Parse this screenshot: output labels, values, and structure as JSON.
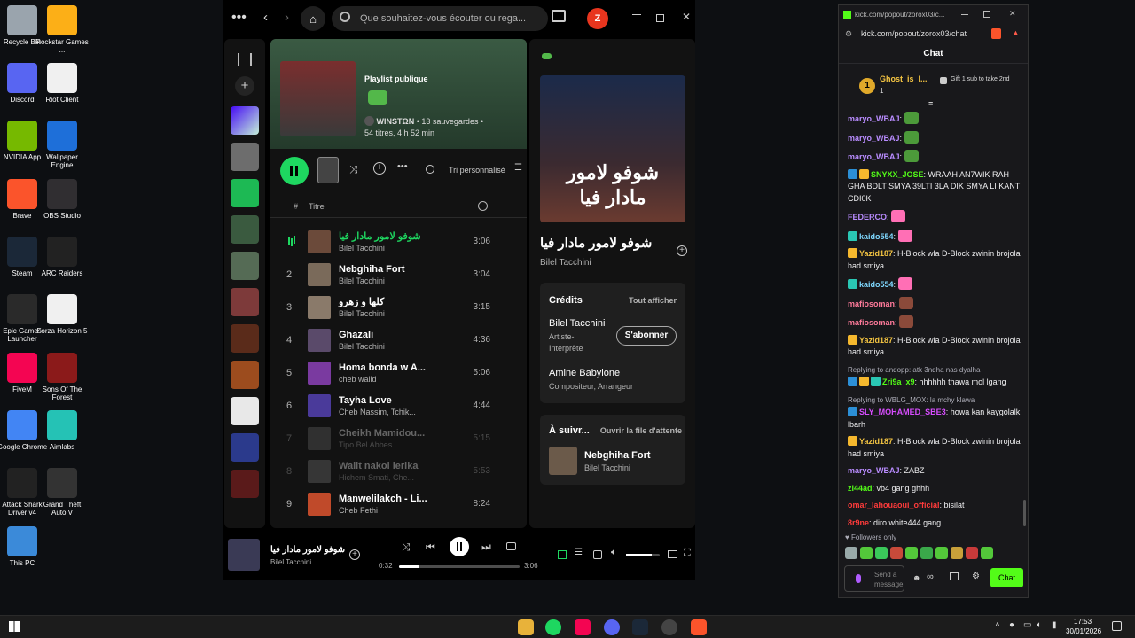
{
  "desktop": {
    "icons": [
      {
        "label": "Recycle Bin",
        "icon": "recycle-bin-icon",
        "color": "#9aa4ad"
      },
      {
        "label": "Rockstar Games ...",
        "icon": "rockstar-icon",
        "color": "#fcaf17"
      },
      {
        "label": "Discord",
        "icon": "discord-icon",
        "color": "#5865f2"
      },
      {
        "label": "Riot Client",
        "icon": "file-icon",
        "color": "#f0f0f0"
      },
      {
        "label": "NVIDIA App",
        "icon": "nvidia-icon",
        "color": "#76b900"
      },
      {
        "label": "Wallpaper Engine",
        "icon": "wallpaper-engine-icon",
        "color": "#1e6fd9"
      },
      {
        "label": "Brave",
        "icon": "brave-icon",
        "color": "#fb542b"
      },
      {
        "label": "OBS Studio",
        "icon": "obs-icon",
        "color": "#302e31"
      },
      {
        "label": "Steam",
        "icon": "steam-icon",
        "color": "#1b2838"
      },
      {
        "label": "ARC Raiders",
        "icon": "arc-raiders-icon",
        "color": "#222"
      },
      {
        "label": "Epic Games Launcher",
        "icon": "epic-icon",
        "color": "#2a2a2a"
      },
      {
        "label": "Forza Horizon 5",
        "icon": "file-icon",
        "color": "#f0f0f0"
      },
      {
        "label": "FiveM",
        "icon": "fivem-icon",
        "color": "#f40552"
      },
      {
        "label": "Sons Of The Forest",
        "icon": "sotf-icon",
        "color": "#8b1a1a"
      },
      {
        "label": "Google Chrome",
        "icon": "chrome-icon",
        "color": "#4285f4"
      },
      {
        "label": "Aimlabs",
        "icon": "aimlabs-icon",
        "color": "#25c2b5"
      },
      {
        "label": "Attack Shark Driver v4",
        "icon": "attack-shark-icon",
        "color": "#222"
      },
      {
        "label": "Grand Theft Auto V",
        "icon": "gta-icon",
        "color": "#333"
      },
      {
        "label": "This PC",
        "icon": "this-pc-icon",
        "color": "#3b8ad9"
      }
    ]
  },
  "spotify": {
    "search_placeholder": "Que souhaitez-vous écouter ou rega...",
    "avatar_letter": "Z",
    "playlist": {
      "type": "Playlist publique",
      "owner": "WINSTΩN",
      "saves": "• 13 sauvegardes •",
      "meta": "54 titres, 4 h 52 min",
      "sort": "Tri personnalisé"
    },
    "columns": {
      "num": "#",
      "title": "Titre"
    },
    "tracks": [
      {
        "n": "",
        "title": "شوفو لامور مادار فيا",
        "artist": "Bilel Tacchini",
        "dur": "3:06",
        "playing": true
      },
      {
        "n": "2",
        "title": "Nebghiha Fort",
        "artist": "Bilel Tacchini",
        "dur": "3:04"
      },
      {
        "n": "3",
        "title": "كلها و زهرو",
        "artist": "Bilel Tacchini",
        "dur": "3:15"
      },
      {
        "n": "4",
        "title": "Ghazali",
        "artist": "Bilel Tacchini",
        "dur": "4:36"
      },
      {
        "n": "5",
        "title": "Homa bonda w A...",
        "artist": "cheb walid",
        "dur": "5:06"
      },
      {
        "n": "6",
        "title": "Tayha Love",
        "artist": "Cheb Nassim, Tchik...",
        "dur": "4:44"
      },
      {
        "n": "7",
        "title": "Cheikh Mamidou...",
        "artist": "Tipo Bel Abbes",
        "dur": "5:15",
        "dim": true
      },
      {
        "n": "8",
        "title": "Walit nakol lerika",
        "artist": "Hichem Smati, Che...",
        "dur": "5:53",
        "dim": true
      },
      {
        "n": "9",
        "title": "Manwelilakch - Li...",
        "artist": "Cheb Fethi",
        "dur": "8:24"
      }
    ],
    "now": {
      "cover_text": "شوفو لامور مادار فيا",
      "title": "شوفو لامور مادار فيا",
      "artist": "Bilel Tacchini"
    },
    "credits": {
      "heading": "Crédits",
      "show_all": "Tout afficher",
      "p1": "Bilel Tacchini",
      "r1": "Artiste-Interprète",
      "follow": "S'abonner",
      "p2": "Amine Babylone",
      "r2": "Compositeur, Arrangeur"
    },
    "queue": {
      "heading": "À suivr...",
      "open": "Ouvrir la file d'attente",
      "title": "Nebghiha Fort",
      "artist": "Bilel Tacchini"
    },
    "player": {
      "title": "شوفو لامور مادار فيا",
      "artist": "Bilel Tacchini",
      "elapsed": "0:32",
      "total": "3:06",
      "progress": 0.17,
      "volume": 0.75
    }
  },
  "chat": {
    "url_tab": "kick.com/popout/zorox03/c...",
    "url": "kick.com/popout/zorox03/chat",
    "title": "Chat",
    "gifter": {
      "rank": "1",
      "name": "Ghost_is_l...",
      "count": "1"
    },
    "gift_text": "Gift 1 sub to take 2nd",
    "messages": [
      {
        "user": "maryo_WBAJ",
        "color": "#b98cff",
        "text": "",
        "emote": "#4c9a3a"
      },
      {
        "user": "maryo_WBAJ",
        "color": "#b98cff",
        "text": "",
        "emote": "#4c9a3a"
      },
      {
        "user": "maryo_WBAJ",
        "color": "#b98cff",
        "text": "",
        "emote": "#4c9a3a"
      },
      {
        "user": "SNYXX_JOSE",
        "color": "#53fc18",
        "text": "WRAAH AN7WIK RAH GHA BDLT SMYA 39LTI 3LA DIK SMYA LI KANT CDI0K",
        "badges": [
          "#2c8fd6",
          "#f5b82e"
        ]
      },
      {
        "user": "FEDERCO",
        "color": "#b98cff",
        "text": "",
        "emote": "#ff6fb5"
      },
      {
        "user": "kaido554",
        "color": "#7fd8ff",
        "text": "",
        "emote": "#ff6fb5",
        "badges": [
          "#2ac7b4"
        ]
      },
      {
        "user": "Yazid187",
        "color": "#f5c542",
        "text": "H-Block wla D-Block zwinin brojola had smiya",
        "badges": [
          "#f5b82e"
        ]
      },
      {
        "user": "kaido554",
        "color": "#7fd8ff",
        "text": "",
        "emote": "#ff6fb5",
        "badges": [
          "#2ac7b4"
        ]
      },
      {
        "user": "mafiosoman",
        "color": "#ff7a9a",
        "text": "",
        "emote": "#8b4a3a"
      },
      {
        "user": "mafiosoman",
        "color": "#ff7a9a",
        "text": "",
        "emote": "#8b4a3a"
      },
      {
        "user": "Yazid187",
        "color": "#f5c542",
        "text": "H-Block wla D-Block zwinin brojola had smiya",
        "badges": [
          "#f5b82e"
        ]
      },
      {
        "reply": "Replying to andopp: atk 3ndha nas dyalha",
        "user": "Zri9a_x9",
        "color": "#53fc18",
        "text": "hhhhhh thawa mol lgang",
        "badges": [
          "#2c8fd6",
          "#f5b82e",
          "#2ac7b4"
        ]
      },
      {
        "reply": "Replying to WBLG_MOX: la mchy klawa",
        "user": "SLY_MOHAMED_SBE3",
        "color": "#d84dff",
        "text": "howa kan kaygolalk lbarh",
        "badges": [
          "#2c8fd6"
        ]
      },
      {
        "user": "Yazid187",
        "color": "#f5c542",
        "text": "H-Block wla D-Block zwinin brojola had smiya",
        "badges": [
          "#f5b82e"
        ]
      },
      {
        "user": "maryo_WBAJ",
        "color": "#b98cff",
        "text": "ZABZ"
      },
      {
        "user": "zi44ad",
        "color": "#53fc18",
        "text": "vb4 gang ghhh"
      },
      {
        "user": "omar_lahouaoui_official",
        "color": "#ff3b3b",
        "text": "bisilat"
      },
      {
        "user": "8r9ne",
        "color": "#ff3b3b",
        "text": "diro white444 gang"
      }
    ],
    "followers_only": "Followers only",
    "input_placeholder": "Send a message",
    "send": "Chat"
  },
  "taskbar": {
    "time": "17:53",
    "date": "30/01/2026"
  }
}
